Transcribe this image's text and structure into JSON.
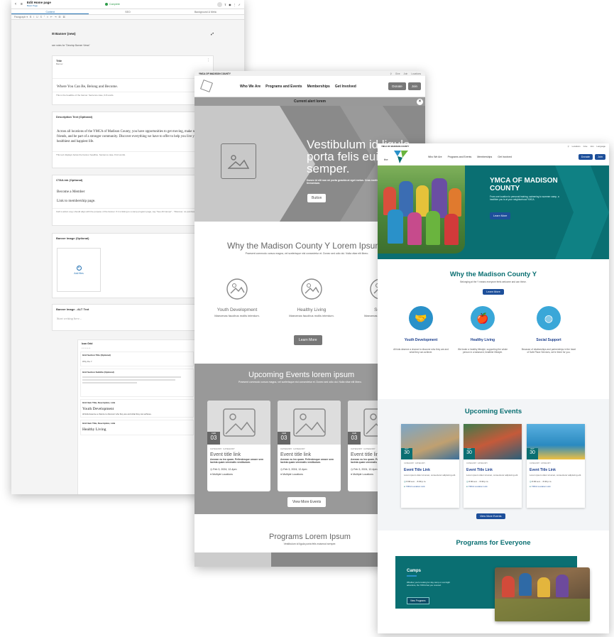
{
  "editor": {
    "page_title": "Edit Home page",
    "page_sub": "Basic Page",
    "status": "Complete",
    "tabs": [
      "Content",
      "SEO",
      "Background & Meta"
    ],
    "toolbar": "Paragraph",
    "banner_heading": "Banner (new)",
    "banner_note": "see notes for \"Develop Banner Views\"",
    "title_label": "Title",
    "title_sub": "Banner",
    "title_value": "Where You Can Be, Belong and Become.",
    "title_help": "This is the headline of the banner. Sentence case, 6-8 words.",
    "desc_label": "Description Text (Optional)",
    "desc_value": "Across all locations of the YMCA of Madison County, you have opportunities to get moving, make new friends, and be part of a stronger community. Discover everything we have to offer to help you live your healthiest and happiest life.",
    "desc_help": "This text displays below the banner headline. Sentence case, 8-12 words.",
    "cta_label": "CTA/Link (Optional)",
    "cta_value1": "Become a Member",
    "cta_value2": "Link to membership page.",
    "cta_help": "Call to action copy should align with the purpose of the banner. If it is linking to a camp program page, say \"See All Camps\" - \"Discover, no punctuation.",
    "image_label": "Banner Image (Optional)",
    "add_files": "Add files",
    "alt_label": "Banner Image - ALT Text",
    "alt_placeholder": "Start writing here...",
    "grid_heading": "Icon Grid",
    "grid_title_label": "Grid Section Title (Optional)",
    "grid_title_value": "Why the Y",
    "grid_subtitle_label": "Grid Section Subtitle (Optional)",
    "item_label": "Grid Item Title, Description, Link",
    "item1": "Youth Development",
    "item1_desc": "All kids deserve a chance to discover who they are and what they can achieve.",
    "item2": "Healthy Living"
  },
  "wireframe": {
    "topbar": "YMCA OF MADISON COUNTY",
    "top_links": [
      "Give",
      "Join",
      "Locations"
    ],
    "nav": [
      "Who We Are",
      "Programs and Events",
      "Memberships",
      "Get Involved"
    ],
    "donate": "Donate",
    "join": "Join",
    "alert": "Current alert lorem",
    "hero_title": "Vestibulum id ligula porta felis euismod semper.",
    "hero_sub": "Donec id elit non mi porta gravida at eget metus. Cras mattis consectetur purus sit amet fermentum.",
    "hero_btn": "Button",
    "why_title": "Why the Madison County Y Lorem Ipsum",
    "why_sub": "Praesent commodo cursus magna, vel scelerisque nisl consectetur et. Donec sed odio dui. Nulla vitae elit libero.",
    "features": [
      {
        "title": "Youth Development",
        "text": "Maecenas faucibus mollis interdum."
      },
      {
        "title": "Healthy Living",
        "text": "Maecenas faucibus mollis interdum."
      },
      {
        "title": "Social",
        "text": "Maecenas faucibus mollis"
      }
    ],
    "learn_more": "Learn More",
    "events_title": "Upcoming Events lorem ipsum",
    "events_sub": "Praesent commodo cursus magna, vel scelerisque nisl consectetur et. Donec sed odio dui. Nulla vitae elit libero.",
    "event_month": "FEB",
    "event_day": "03",
    "event_cats": "CATEGORY  CATEGORY",
    "event_title": "Event title link",
    "event_desc": "Aenean eu leo quam. Pellentesque ornare sem lacinia quam venenatis vestibulum.",
    "event_date": "Feb 3, 2024, 12-4pm",
    "event_loc": "Multiple Locations",
    "view_more": "View More Events",
    "programs_title": "Programs Lorem Ipsum",
    "programs_sub": "Vestibulum id ligula porta felis euismod semper."
  },
  "final": {
    "topbar": "YMCA OF MADISON COUNTY",
    "top_links": [
      "Locations",
      "Give",
      "Join",
      "Language"
    ],
    "nav": [
      "Who We Are",
      "Programs and Events",
      "Memberships",
      "Get Involved"
    ],
    "donate": "Donate",
    "join": "Join",
    "hero_title": "YMCA OF MADISON COUNTY",
    "hero_sub": "From one location to personal training, swimming to summer camp, a healthier you is at your neighborhood YMCA.",
    "hero_btn": "Learn More",
    "why_title": "Why the Madison County Y",
    "why_sub": "Belonging at the Y means everyone feels welcome and can thrive.",
    "why_btn": "Learn More",
    "features": [
      {
        "title": "Youth Development",
        "text": "All kids deserve a chance to discover who they are and what they can achieve."
      },
      {
        "title": "Healthy Living",
        "text": "We foster a healthy lifestyle, supporting the whole person in a balanced, healthier lifestyle."
      },
      {
        "title": "Social Support",
        "text": "Because of relationships and partnerships in the heart of Safe Place Services, we're there for you."
      }
    ],
    "events_title": "Upcoming Events",
    "events": [
      {
        "day": "30",
        "title": "Event Title Link",
        "time": "6:00 a.m. - 6:30 p.m.",
        "loc": "YMCA Location Link"
      },
      {
        "day": "30",
        "title": "Event Title Link",
        "time": "6:00 a.m. - 6:30 p.m.",
        "loc": "YMCA Location Link"
      },
      {
        "day": "30",
        "title": "Event Title Link",
        "time": "6:00 a.m. - 6:30 p.m.",
        "loc": "YMCA Location Link"
      }
    ],
    "event_month": "OCT",
    "event_cats": "CATEGORY  CATEGORY",
    "event_desc": "Lorem ipsum dolor sit amet, consectetur adipiscing elit.",
    "view_more": "View More Events",
    "programs_title": "Programs for Everyone",
    "camps_title": "Camps",
    "camps_text": "Whether you're looking for day camp or overnight adventure, the YMCA has you covered.",
    "camps_btn": "View Programs",
    "colors": {
      "teal": "#0a6f72",
      "navy": "#1d4f9a",
      "green": "#6ab43e",
      "blue": "#2a91c9"
    }
  }
}
